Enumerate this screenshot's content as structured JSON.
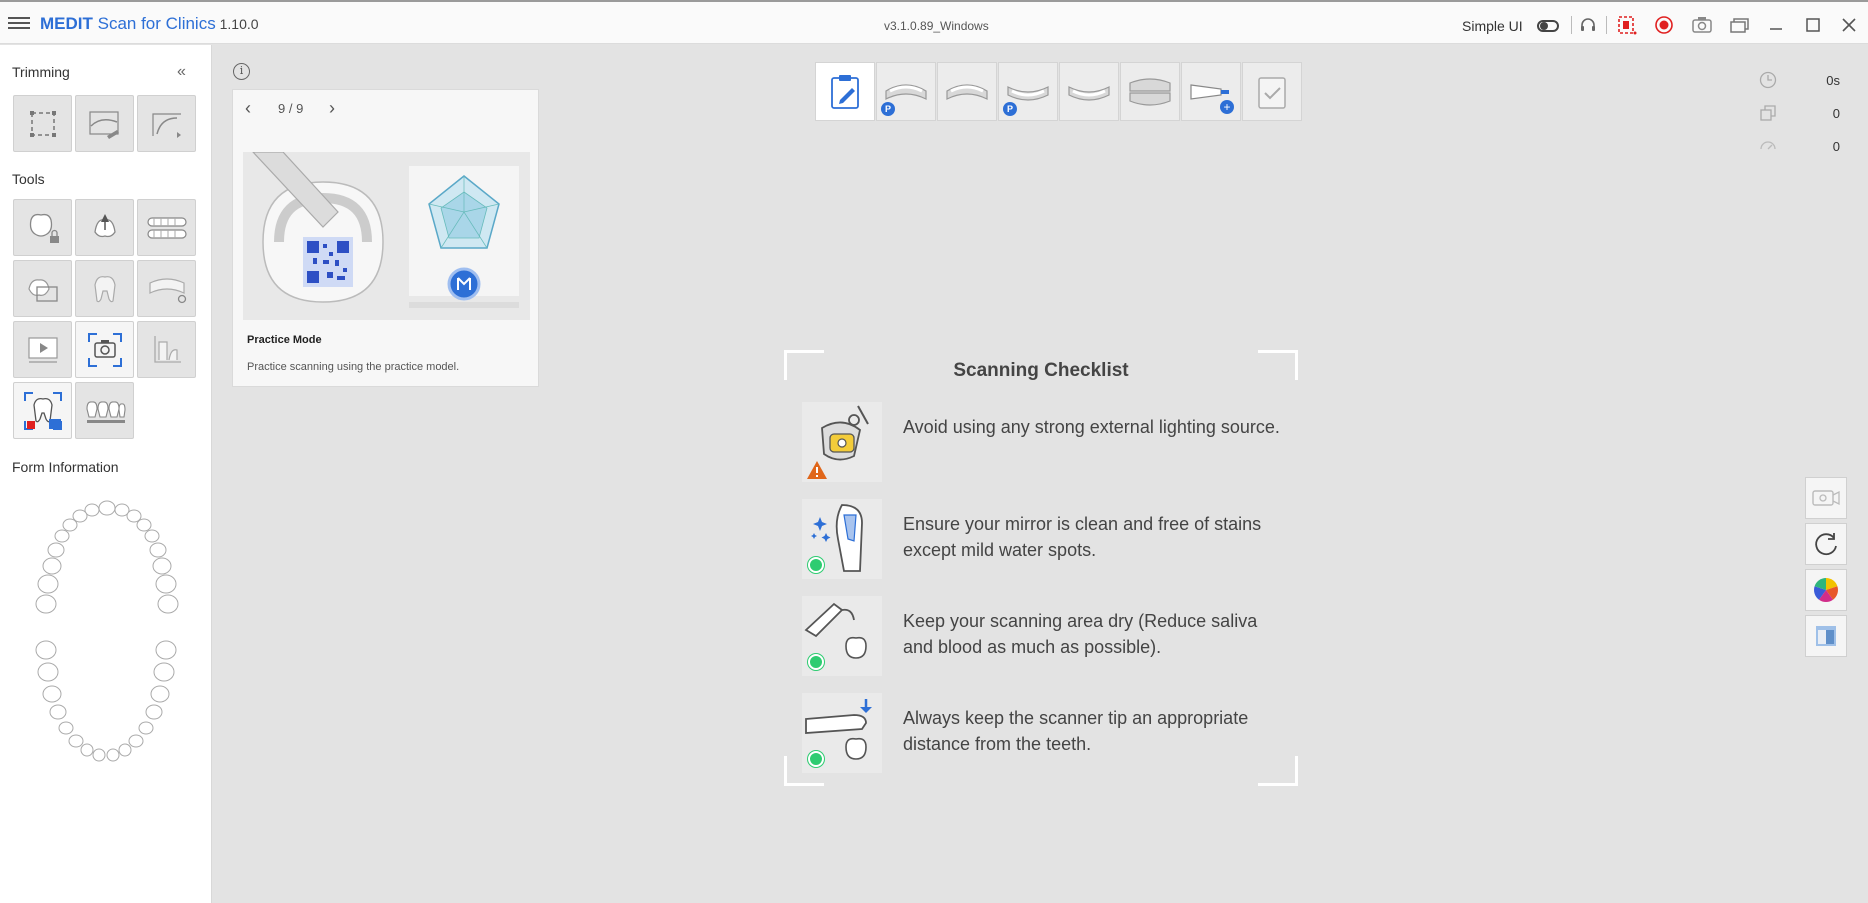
{
  "titlebar": {
    "brand": "MEDIT",
    "app_name": " Scan for Clinics",
    "app_version": " 1.10.0",
    "build_version": "v3.1.0.89_Windows",
    "simple_ui_label": "Simple UI"
  },
  "sidebar": {
    "trimming_label": "Trimming",
    "tools_label": "Tools",
    "form_information_label": "Form Information"
  },
  "practice_card": {
    "pager": "9 / 9",
    "title": "Practice Mode",
    "description": "Practice scanning using the practice model."
  },
  "stats": {
    "time": "0s",
    "shots": "0",
    "other": "0"
  },
  "checklist": {
    "title": "Scanning Checklist",
    "items": [
      {
        "text": "Avoid using any strong external lighting source.",
        "status": "warning"
      },
      {
        "text": "Ensure your mirror is clean and free of stains except mild water spots.",
        "status": "ok"
      },
      {
        "text": "Keep your scanning area dry (Reduce saliva and blood as much as possible).",
        "status": "ok"
      },
      {
        "text": "Always keep the scanner tip an appropriate distance from the teeth.",
        "status": "ok"
      }
    ]
  },
  "colors": {
    "accent": "#2d6fd6",
    "ok": "#2ecc71",
    "warning": "#e0661a",
    "record": "#e02020"
  }
}
